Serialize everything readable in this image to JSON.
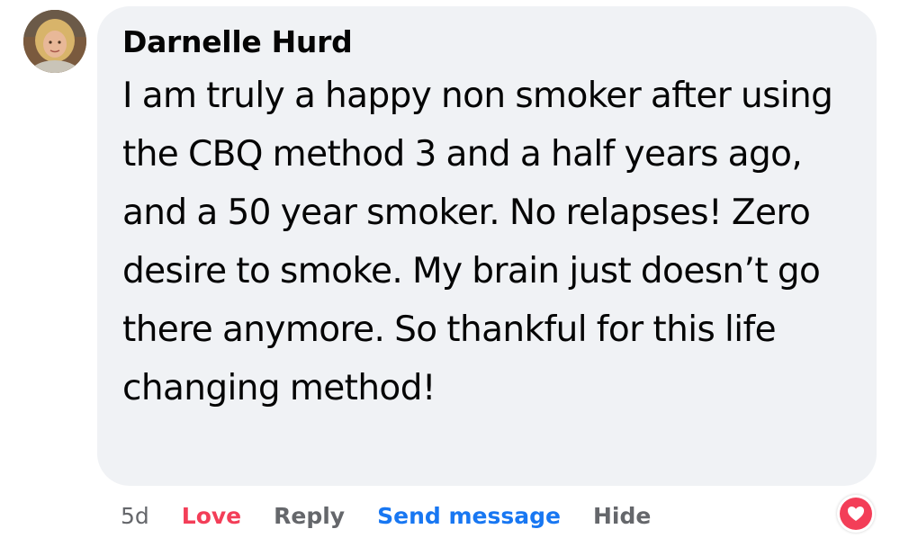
{
  "comment": {
    "author": "Darnelle Hurd",
    "text": "I am truly a happy non smoker after using the CBQ method 3 and a half years ago, and a 50 year smoker. No relapses! Zero desire to smoke. My brain just doesn’t go there anymore. So thankful for this life changing method!",
    "avatar_icon": "profile-photo",
    "bubble_color": "#f0f2f5"
  },
  "actions": {
    "time": "5d",
    "love_label": "Love",
    "reply_label": "Reply",
    "send_message_label": "Send message",
    "hide_label": "Hide"
  },
  "reaction": {
    "icon": "heart-icon",
    "color": "#f33e58"
  }
}
